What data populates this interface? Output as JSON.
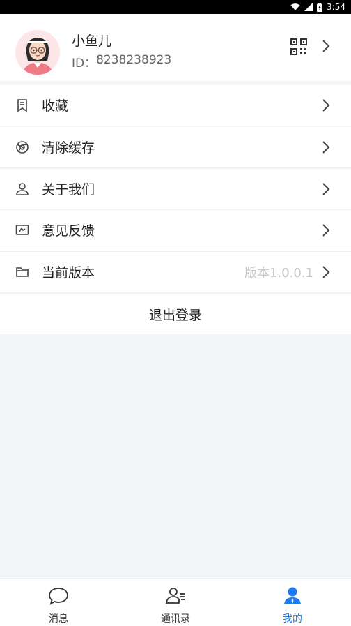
{
  "status_bar": {
    "time": "3:54"
  },
  "profile": {
    "name": "小鱼儿",
    "id_label": "ID：",
    "id_value": "8238238923"
  },
  "menu": {
    "favorites": "收藏",
    "clear_cache": "清除缓存",
    "about_us": "关于我们",
    "feedback": "意见反馈",
    "version_label": "当前版本",
    "version_value": "版本1.0.0.1",
    "logout": "退出登录"
  },
  "tabs": [
    {
      "label": "消息",
      "icon": "chat-bubble-icon",
      "active": false
    },
    {
      "label": "通讯录",
      "icon": "contacts-icon",
      "active": false
    },
    {
      "label": "我的",
      "icon": "user-icon",
      "active": true
    }
  ],
  "colors": {
    "accent": "#1a7cf0",
    "background": "#f4f5f7"
  }
}
